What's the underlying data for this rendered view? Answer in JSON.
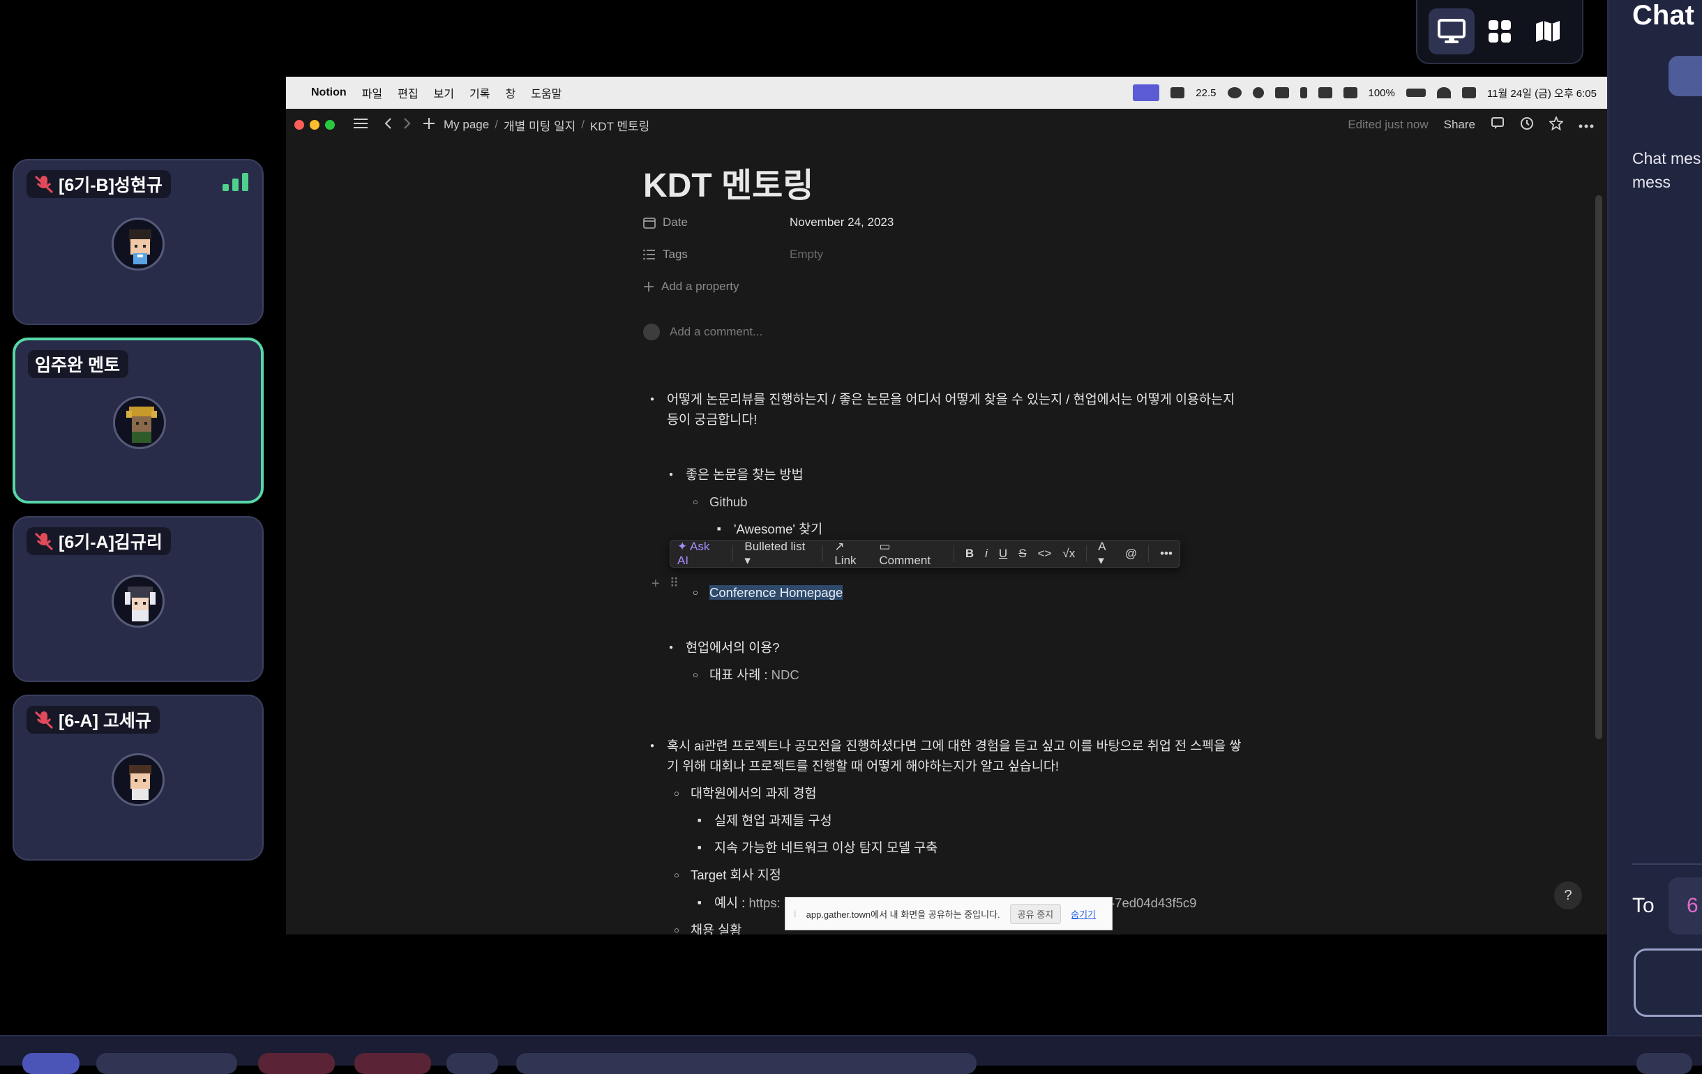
{
  "view_toggle": {
    "icons": [
      "desktop-icon",
      "grid-icon",
      "map-icon"
    ],
    "active": "desktop-icon"
  },
  "participants": [
    {
      "name": "[6기-B]성현규",
      "muted": true,
      "signal": true
    },
    {
      "name": "임주완 멘토",
      "muted": false,
      "active": true
    },
    {
      "name": "[6기-A]김규리",
      "muted": true
    },
    {
      "name": "[6-A] 고세규",
      "muted": true
    }
  ],
  "mac_menubar": {
    "app": "Notion",
    "menus": [
      "파일",
      "편집",
      "보기",
      "기록",
      "창",
      "도움말"
    ],
    "status": {
      "speed": "22.5",
      "battery": "100%",
      "datetime": "11월 24일 (금) 오후 6:05"
    }
  },
  "notion_topbar": {
    "breadcrumbs": [
      "My page",
      "개별 미팅 일지",
      "KDT 멘토링"
    ],
    "edited": "Edited just now",
    "share": "Share"
  },
  "page": {
    "title": "KDT 멘토링",
    "properties": [
      {
        "label": "Date",
        "value": "November 24, 2023"
      },
      {
        "label": "Tags",
        "value": "Empty"
      }
    ],
    "add_property": "Add a property",
    "add_comment": "Add a comment..."
  },
  "content": {
    "q1_line1": "어떻게 논문리뷰를 진행하는지 / 좋은 논문을 어디서 어떻게 찾을 수 있는지 / 현업에서는 어떻게 이용하는지",
    "q1_line2": "등이 궁금합니다!",
    "how_to_find": "좋은 논문을 찾는 방법",
    "github": "Github",
    "awesome": "'Awesome' 찾기",
    "conference": "Conference Homepage",
    "industry_use": "현업에서의 이용?",
    "example_label": "대표 사례 : ",
    "example_value": "NDC",
    "q2_line1": "혹시 ai관련 프로젝트나 공모전을 진행하셨다면 그에 대한 경험을 듣고 싶고 이를 바탕으로 취업 전 스펙을 쌓",
    "q2_line2": "기 위해 대회나 프로젝트를 진행할 때 어떻게 해야하는지가 알고 싶습니다!",
    "grad_exp": "대학원에서의 과제 경험",
    "real_tasks": "실제 현업 과제들 구성",
    "network_model": "지속 가능한 네트워크 이상 탐지 모델 구축",
    "target": "Target 회사 지정",
    "example2_label": "예시 : ",
    "example2_prefix": "https:",
    "example2_suffix": "-7ed04d43f5c9",
    "hiring": "채용 실황"
  },
  "toolbar": {
    "ask_ai": "Ask AI",
    "block_type": "Bulleted list",
    "link": "Link",
    "comment": "Comment",
    "bold": "B",
    "italic": "i",
    "underline": "U",
    "strike": "S",
    "color": "A",
    "mention": "@"
  },
  "share_banner": {
    "text": "app.gather.town에서 내 화면을 공유하는 중입니다.",
    "stop": "공유 중지",
    "hide": "숨기기"
  },
  "help": "?",
  "chat": {
    "title": "Chat",
    "description": "Chat mes in this pri see mess",
    "to_label": "To",
    "recipient": "6"
  }
}
